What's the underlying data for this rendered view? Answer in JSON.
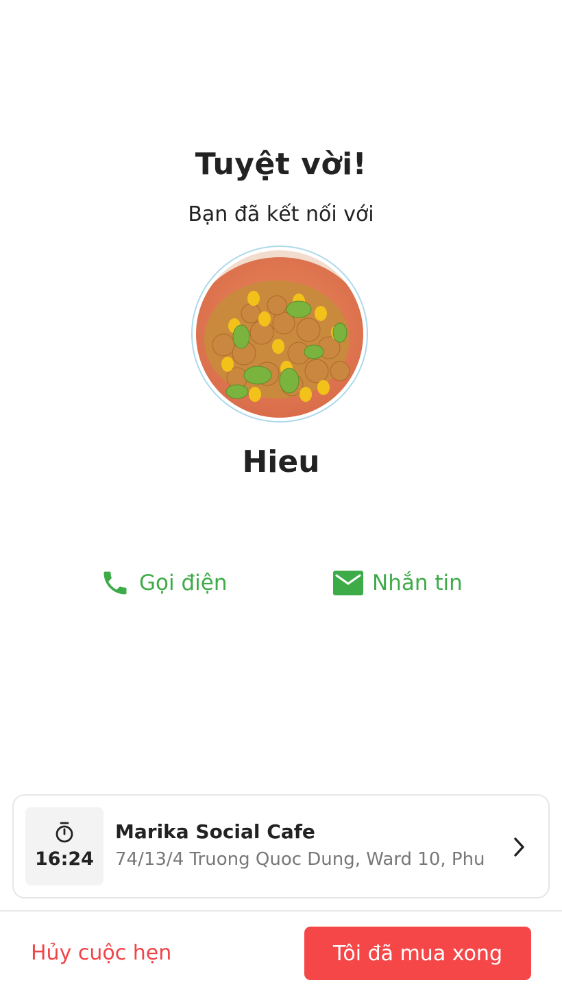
{
  "header": {
    "title": "Tuyệt vời!",
    "subtitle": "Bạn đã kết nối với"
  },
  "contact": {
    "avatar_alt": "food-photo",
    "name": "Hieu"
  },
  "actions": {
    "call": {
      "label": "Gọi điện",
      "icon": "phone-icon"
    },
    "message": {
      "label": "Nhắn tin",
      "icon": "mail-icon"
    }
  },
  "appointment": {
    "time": "16:24",
    "time_icon": "stopwatch-icon",
    "place_name": "Marika Social Cafe",
    "address": "74/13/4 Truong Quoc Dung, Ward 10, Phu",
    "chevron_icon": "chevron-right-icon"
  },
  "footer": {
    "cancel_label": "Hủy cuộc hẹn",
    "done_label": "Tôi đã mua xong"
  },
  "colors": {
    "accent_green": "#3dab48",
    "accent_red": "#f54648",
    "text_primary": "#222222",
    "text_secondary": "#777777"
  }
}
